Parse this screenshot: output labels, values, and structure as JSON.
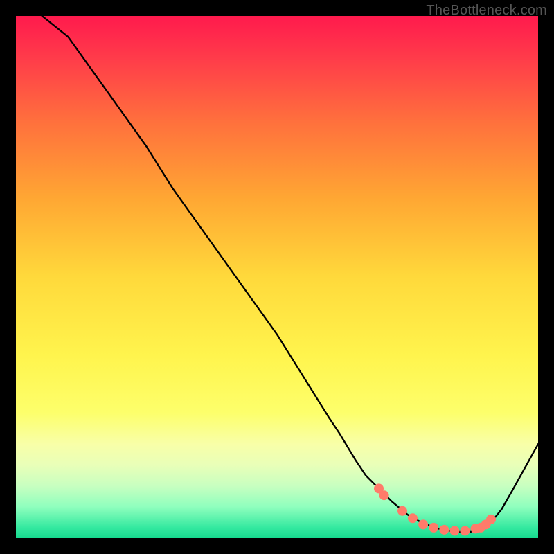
{
  "watermark": "TheBottleneck.com",
  "chart_data": {
    "type": "line",
    "title": "",
    "xlabel": "",
    "ylabel": "",
    "xlim": [
      0,
      100
    ],
    "ylim": [
      0,
      100
    ],
    "series": [
      {
        "name": "curve",
        "x": [
          5,
          10,
          15,
          20,
          25,
          30,
          35,
          40,
          45,
          50,
          55,
          60,
          62,
          65,
          67,
          69,
          72,
          75,
          78,
          81,
          84,
          87,
          89,
          91,
          93,
          95,
          100
        ],
        "y": [
          100,
          96,
          89,
          82,
          75,
          67,
          60,
          53,
          46,
          39,
          31,
          23,
          20,
          15,
          12,
          10,
          7,
          4.5,
          2.8,
          1.8,
          1.2,
          1.2,
          1.6,
          3,
          5.5,
          9,
          18
        ]
      }
    ],
    "markers": {
      "name": "optimum-band",
      "x": [
        69.5,
        70.5,
        74,
        76,
        78,
        80,
        82,
        84,
        86,
        88,
        89,
        90,
        91
      ],
      "y": [
        9.5,
        8.2,
        5.2,
        3.8,
        2.6,
        2.0,
        1.6,
        1.4,
        1.4,
        1.8,
        2.0,
        2.6,
        3.6
      ]
    },
    "gradient_bands": [
      {
        "color": "#ff1a4d",
        "stop": 0
      },
      {
        "color": "#ffd93b",
        "stop": 50
      },
      {
        "color": "#fdff6b",
        "stop": 76
      },
      {
        "color": "#16d98e",
        "stop": 100
      }
    ]
  }
}
